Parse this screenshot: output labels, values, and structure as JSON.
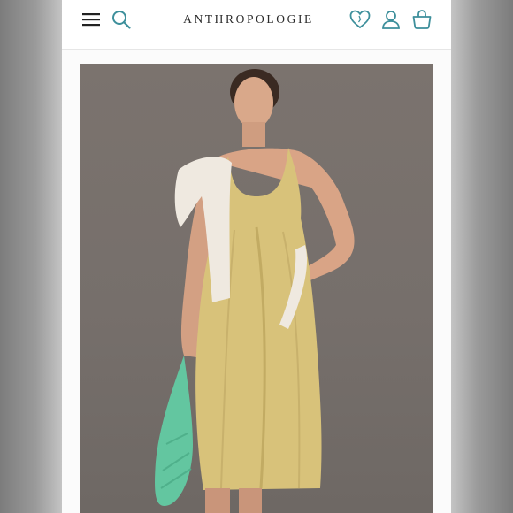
{
  "header": {
    "logo_text": "ANTHROPOLOGIE",
    "icons": {
      "menu": "hamburger-menu-icon",
      "search": "search-icon",
      "wishlist": "heart-icon",
      "account": "user-icon",
      "bag": "shopping-bag-icon"
    },
    "accent_color": "#3d8f9b"
  },
  "product": {
    "image": "model-wearing-yellow-midi-slip-dress-with-cream-sweater-and-green-bag",
    "dress_color": "#d8c27a",
    "background_color": "#7a726d"
  }
}
